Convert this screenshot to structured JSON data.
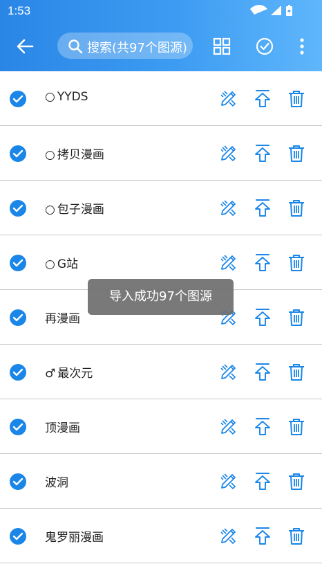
{
  "status_bar": {
    "time": "1:53"
  },
  "app_bar": {
    "back_icon": "arrow-left-icon",
    "search_placeholder": "搜索(共97个图源)",
    "actions": [
      "grid-icon",
      "check-circle-icon",
      "more-vert-icon"
    ]
  },
  "colors": {
    "accent": "#1a86e8",
    "appbar_start": "#2a86e6",
    "appbar_end": "#5fb6fb"
  },
  "sources": [
    {
      "prefix": "○",
      "name": "YYDS",
      "checked": true
    },
    {
      "prefix": "○",
      "name": "拷贝漫画",
      "checked": true
    },
    {
      "prefix": "○",
      "name": "包子漫画",
      "checked": true
    },
    {
      "prefix": "○",
      "name": "G站",
      "checked": true
    },
    {
      "prefix": "",
      "name": "再漫画",
      "checked": true
    },
    {
      "prefix": "♂",
      "name": "最次元",
      "checked": true
    },
    {
      "prefix": "",
      "name": "顶漫画",
      "checked": true
    },
    {
      "prefix": "",
      "name": "波洞",
      "checked": true
    },
    {
      "prefix": "",
      "name": "鬼罗丽漫画",
      "checked": true
    }
  ],
  "row_actions": [
    "edit-icon",
    "move-to-top-icon",
    "delete-icon"
  ],
  "toast": "导入成功97个图源"
}
